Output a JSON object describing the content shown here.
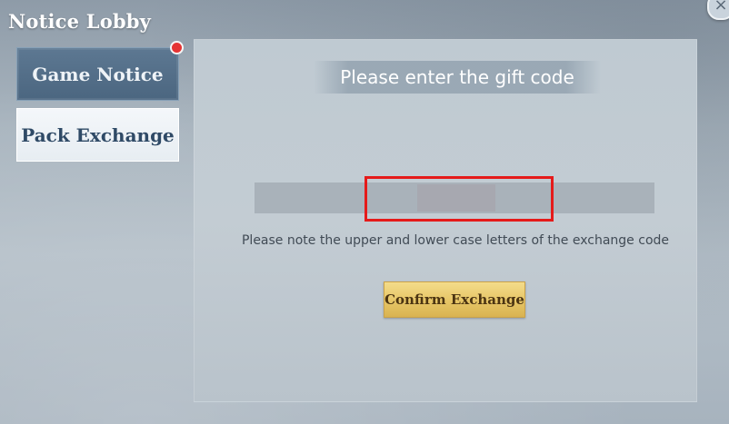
{
  "window": {
    "title": "Notice Lobby",
    "close_label": "×"
  },
  "tabs": [
    {
      "label": "Game Notice",
      "selected": false,
      "has_notification_dot": true
    },
    {
      "label": "Pack Exchange",
      "selected": true,
      "has_notification_dot": false
    }
  ],
  "exchange": {
    "header": "Please enter the gift code",
    "input_value": "",
    "input_placeholder": "",
    "note": "Please note the upper and lower case letters of the exchange code",
    "confirm_label": "Confirm Exchange"
  },
  "colors": {
    "notification_dot": "#e53434",
    "highlight_border": "#e51a1a",
    "confirm_button": "#e6c566"
  },
  "icons": {
    "close": "close-icon",
    "notification": "red-dot-icon"
  }
}
